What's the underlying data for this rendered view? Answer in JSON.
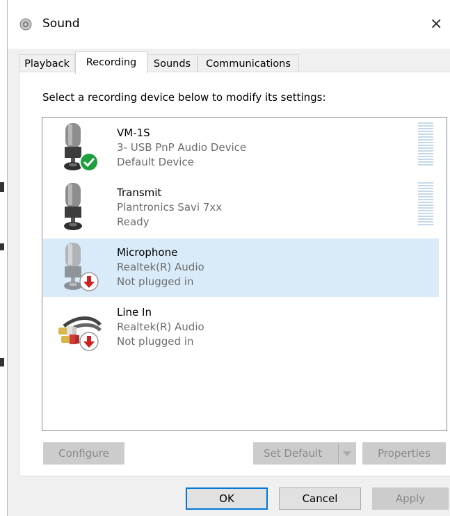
{
  "window": {
    "title": "Sound",
    "close_glyph": "×"
  },
  "tabs": [
    {
      "label": "Playback",
      "active": false
    },
    {
      "label": "Recording",
      "active": true
    },
    {
      "label": "Sounds",
      "active": false
    },
    {
      "label": "Communications",
      "active": false
    }
  ],
  "prompt": "Select a recording device below to modify its settings:",
  "devices": [
    {
      "name": "VM-1S",
      "driver": "3- USB PnP Audio Device",
      "status": "Default Device",
      "icon": "microphone-icon",
      "badge": "green-check-icon",
      "selected": false,
      "meter": true
    },
    {
      "name": "Transmit",
      "driver": "Plantronics Savi 7xx",
      "status": "Ready",
      "icon": "microphone-icon",
      "badge": "",
      "selected": false,
      "meter": true
    },
    {
      "name": "Microphone",
      "driver": "Realtek(R) Audio",
      "status": "Not plugged in",
      "icon": "microphone-icon",
      "badge": "red-down-arrow-icon",
      "selected": true,
      "meter": false
    },
    {
      "name": "Line In",
      "driver": "Realtek(R) Audio",
      "status": "Not plugged in",
      "icon": "rca-cable-icon",
      "badge": "red-down-arrow-icon",
      "selected": false,
      "meter": false
    }
  ],
  "buttons": {
    "configure": "Configure",
    "set_default": "Set Default",
    "properties": "Properties",
    "ok": "OK",
    "cancel": "Cancel",
    "apply": "Apply"
  },
  "colors": {
    "selection": "#d9ebf9",
    "default_badge": "#1e9e3c",
    "unplugged_badge": "#d21f1f",
    "focus_border": "#0078d7"
  }
}
